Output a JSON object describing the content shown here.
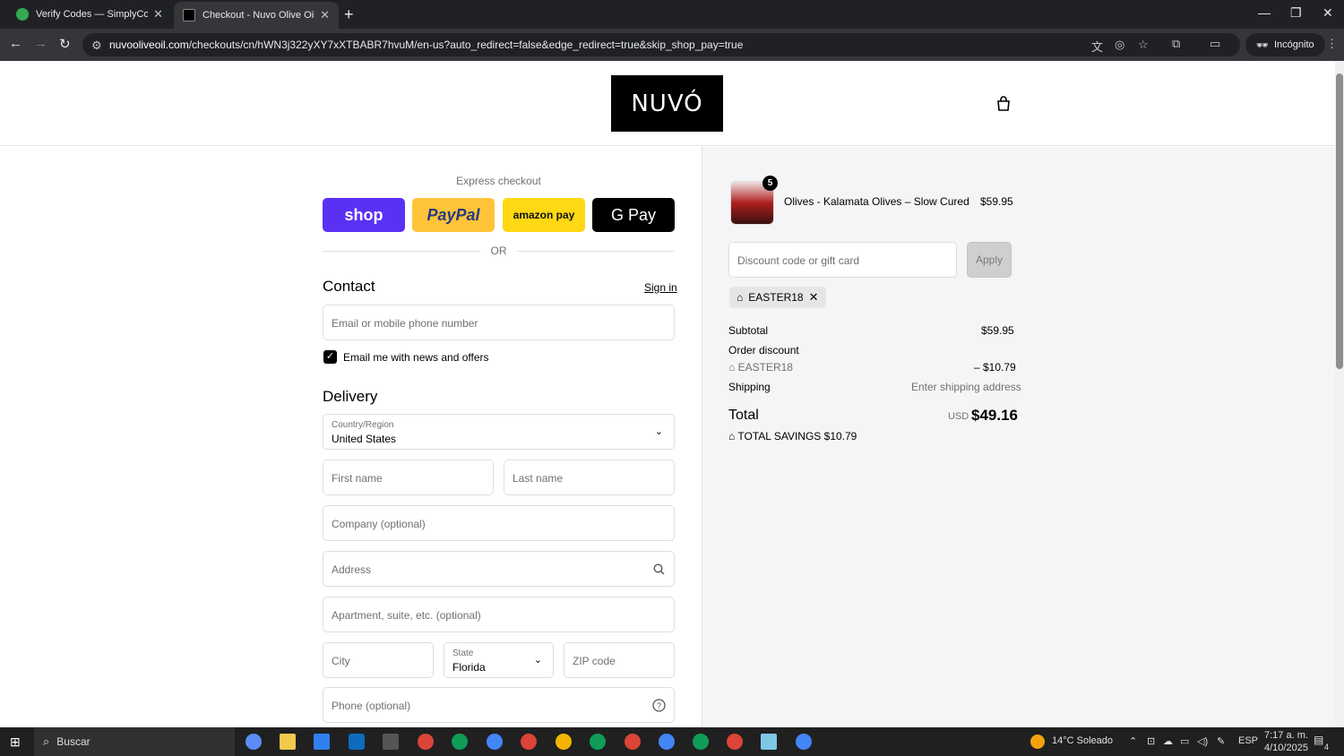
{
  "browser": {
    "tabs": [
      {
        "title": "Verify Codes — SimplyCodes"
      },
      {
        "title": "Checkout - Nuvo Olive Oil"
      }
    ],
    "url_host": "nuvooliveoil.com",
    "url_path": "/checkouts/cn/hWN3j322yXY7xXTBABR7hvuM/en-us?auto_redirect=false&edge_redirect=true&skip_shop_pay=true",
    "incognito_label": "Incógnito"
  },
  "store": {
    "logo_text": "NUVÓ"
  },
  "express": {
    "title": "Express checkout",
    "buttons": [
      {
        "label": "shop",
        "color": "#5a31f4"
      },
      {
        "label": "PayPal",
        "color": "#ffc439"
      },
      {
        "label": "amazon pay",
        "color": "#ffd814"
      },
      {
        "label": "G Pay",
        "color": "#000000"
      }
    ],
    "or_label": "OR"
  },
  "contact": {
    "title": "Contact",
    "signin": "Sign in",
    "email_placeholder": "Email or mobile phone number",
    "newsletter_label": "Email me with news and offers",
    "newsletter_checked": true
  },
  "delivery": {
    "title": "Delivery",
    "country_label": "Country/Region",
    "country_value": "United States",
    "first_name": "First name",
    "last_name": "Last name",
    "company": "Company (optional)",
    "address": "Address",
    "apartment": "Apartment, suite, etc. (optional)",
    "city": "City",
    "state_label": "State",
    "state_value": "Florida",
    "zip": "ZIP code",
    "phone": "Phone (optional)"
  },
  "summary": {
    "product": {
      "name": "Olives - Kalamata Olives – Slow Cured",
      "price": "$59.95",
      "quantity": "5"
    },
    "discount_placeholder": "Discount code or gift card",
    "apply_label": "Apply",
    "applied_code": "EASTER18",
    "subtotal_label": "Subtotal",
    "subtotal_value": "$59.95",
    "order_discount_label": "Order discount",
    "discount_code": "EASTER18",
    "discount_value": "– $10.79",
    "shipping_label": "Shipping",
    "shipping_value": "Enter shipping address",
    "total_label": "Total",
    "currency": "USD",
    "total_value": "$49.16",
    "savings_label": "TOTAL SAVINGS",
    "savings_value": "$10.79"
  },
  "taskbar": {
    "search_label": "Buscar",
    "weather": "14°C  Soleado",
    "lang": "ESP",
    "time": "7:17 a. m.",
    "date": "4/10/2025",
    "notif_count": "4"
  }
}
